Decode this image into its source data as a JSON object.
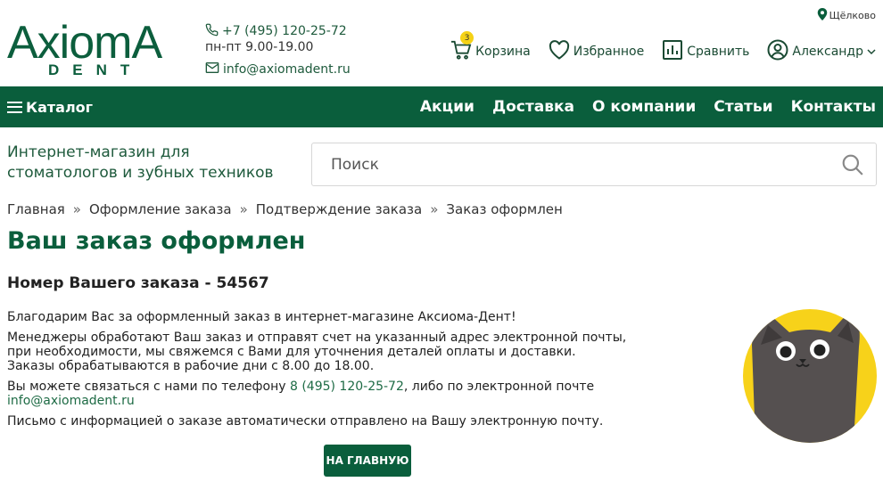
{
  "brand": {
    "name": "AxiomA",
    "sub": "DENT"
  },
  "contacts": {
    "phone": "+7 (495) 120-25-72",
    "hours": "пн-пт 9.00-19.00",
    "email": "info@axiomadent.ru"
  },
  "city": "Щёлково",
  "actions": {
    "cart_label": "Корзина",
    "cart_count": "3",
    "favorites_label": "Избранное",
    "compare_label": "Сравнить",
    "user_label": "Александр"
  },
  "nav": {
    "catalog_label": "Каталог",
    "links": [
      "Акции",
      "Доставка",
      "О компании",
      "Статьи",
      "Контакты"
    ]
  },
  "tagline": "Интернет-магазин для стоматологов и зубных техников",
  "search": {
    "placeholder": "Поиск"
  },
  "breadcrumb": [
    "Главная",
    "Оформление заказа",
    "Подтверждение заказа",
    "Заказ оформлен"
  ],
  "breadcrumb_sep": "»",
  "page_title": "Ваш заказ оформлен",
  "order_number": "Номер Вашего заказа - 54567",
  "message": {
    "thanks": "Благодарим Вас за оформленный заказ в интернет-магазине Аксиома-Дент!",
    "managers": "Менеджеры обработают Ваш заказ и отправят счет на указанный адрес электронной почты, при необходимости, мы свяжемся с Вами для уточнения деталей оплаты и доставки.",
    "hours": "Заказы обрабатываются в рабочие дни с 8.00 до 18.00.",
    "contact_prefix": "Вы можете связаться с нами по телефону ",
    "contact_phone": "8 (495) 120-25-72",
    "contact_middle": ", либо по электронной почте ",
    "contact_email": "info@axiomadent.ru",
    "auto_email": "Письмо с информацией о заказе автоматически отправлено на Вашу электронную почту."
  },
  "home_button": "НА ГЛАВНУЮ",
  "colors": {
    "brand_green": "#0a5e3c",
    "badge_yellow": "#f5d216",
    "mascot_yellow": "#f7d21a"
  }
}
